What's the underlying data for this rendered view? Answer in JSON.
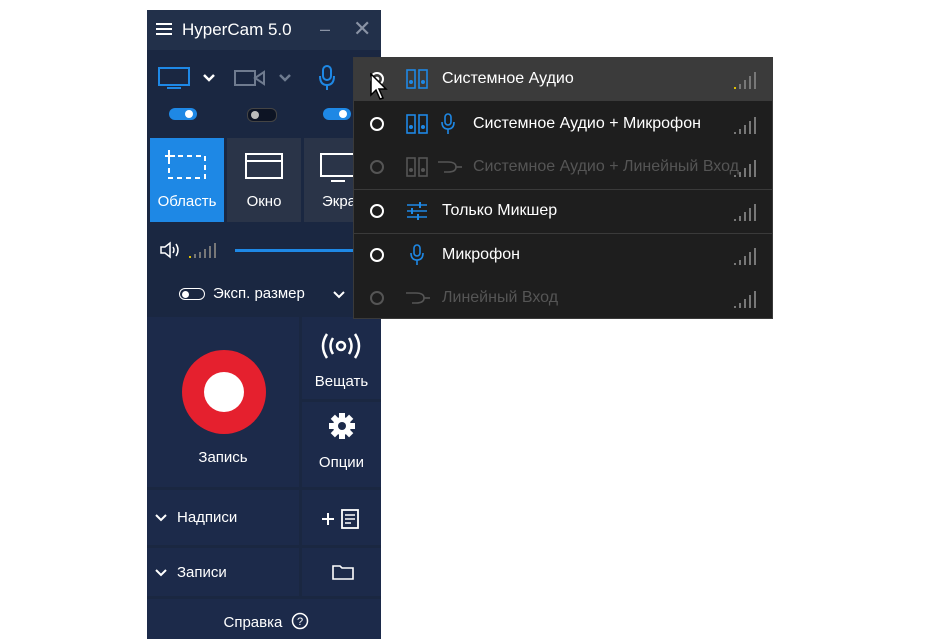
{
  "app": {
    "title": "HyperCam 5.0",
    "minimize": "–",
    "close": "✕"
  },
  "toggles": {
    "screen_on": true,
    "webcam_on": false,
    "mic_on": true
  },
  "modes": [
    {
      "label": "Область",
      "icon": "region-icon",
      "active": true
    },
    {
      "label": "Окно",
      "icon": "window-icon",
      "active": false
    },
    {
      "label": "Экра",
      "icon": "screen-icon",
      "active": false
    }
  ],
  "export_size_label": "Эксп. размер",
  "record_label": "Запись",
  "broadcast_label": "Вещать",
  "options_label": "Опции",
  "captions_label": "Надписи",
  "recordings_label": "Записи",
  "help_label": "Справка",
  "audio_menu": {
    "items": [
      {
        "label": "Системное Аудио",
        "icons": [
          "speaker-icon"
        ],
        "selected": true,
        "disabled": false
      },
      {
        "label": "Системное Аудио + Микрофон",
        "icons": [
          "speaker-icon",
          "mic-icon"
        ],
        "selected": false,
        "disabled": false
      },
      {
        "label": "Системное Аудио + Линейный Вход",
        "icons": [
          "speaker-icon",
          "cable-icon"
        ],
        "selected": false,
        "disabled": true
      },
      {
        "label": "Только Микшер",
        "icons": [
          "mixer-icon"
        ],
        "selected": false,
        "disabled": false
      },
      {
        "label": "Микрофон",
        "icons": [
          "mic-icon"
        ],
        "selected": false,
        "disabled": false
      },
      {
        "label": "Линейный Вход",
        "icons": [
          "cable-icon"
        ],
        "selected": false,
        "disabled": true
      }
    ]
  },
  "colors": {
    "accent": "#1e88e5",
    "record_red": "#e5202e",
    "panel": "#1a2741"
  }
}
